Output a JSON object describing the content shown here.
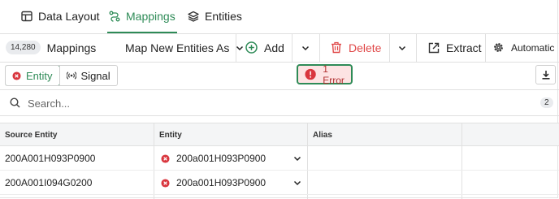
{
  "tabs": [
    {
      "label": "Data Layout",
      "icon": "table-icon",
      "active": false
    },
    {
      "label": "Mappings",
      "icon": "mappings-icon",
      "active": true
    },
    {
      "label": "Entities",
      "icon": "layers-icon",
      "active": false
    }
  ],
  "toolbar": {
    "count": "14,280",
    "count_label": "Mappings",
    "map_dropdown_label": "Map New Entities As",
    "add_label": "Add",
    "delete_label": "Delete",
    "extract_label": "Extract",
    "automatic_label": "Automatic"
  },
  "filters": {
    "entity_label": "Entity",
    "signal_label": "Signal",
    "error_badge": "1 Error"
  },
  "search": {
    "placeholder": "Search...",
    "result_count": "2"
  },
  "grid": {
    "columns": [
      "Source Entity",
      "Entity",
      "Alias"
    ],
    "rows": [
      {
        "source": "200A001H093P0900",
        "entity": "200a001H093P0900",
        "alias": ""
      },
      {
        "source": "200A001I094G0200",
        "entity": "200a001H093P0900",
        "alias": ""
      }
    ]
  },
  "colors": {
    "accent": "#2e8b57",
    "error": "#d9363e",
    "delete": "#e04848"
  }
}
